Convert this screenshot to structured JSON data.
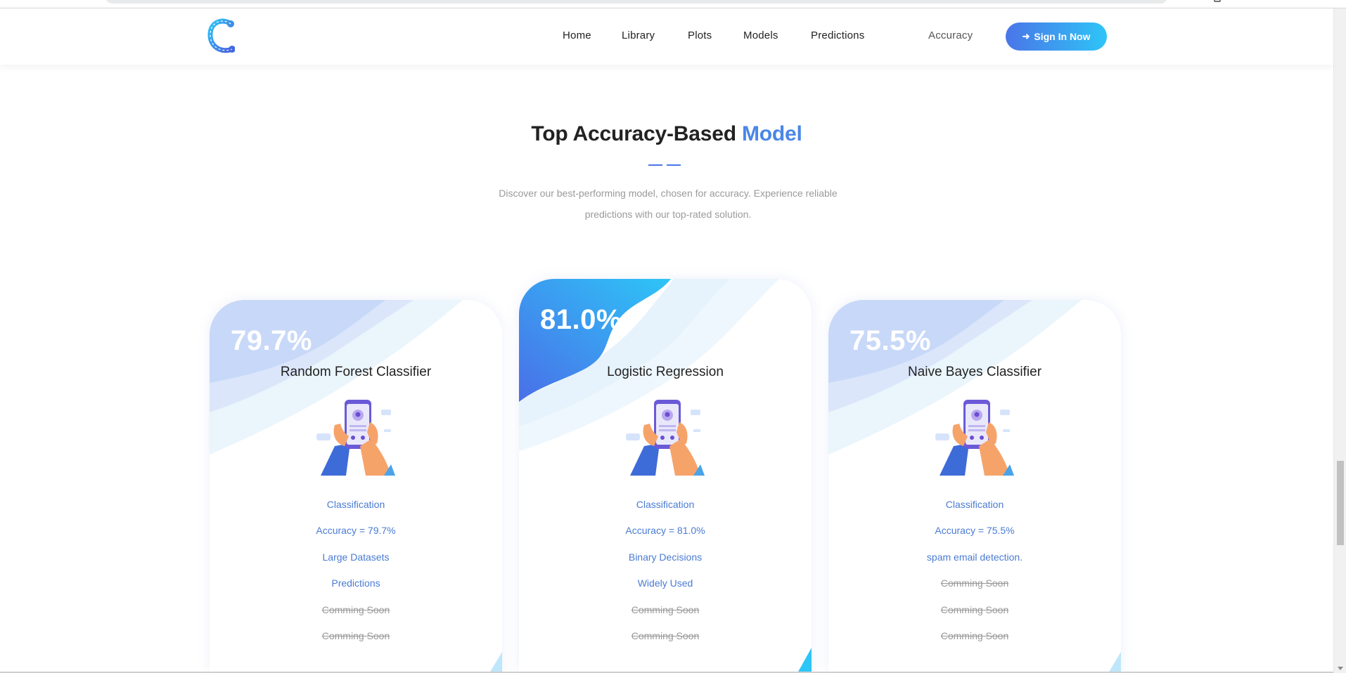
{
  "nav": {
    "items": [
      {
        "label": "Home"
      },
      {
        "label": "Library"
      },
      {
        "label": "Plots"
      },
      {
        "label": "Models"
      },
      {
        "label": "Predictions"
      },
      {
        "label": "Accuracy"
      }
    ],
    "signin_label": "Sign In Now",
    "signin_icon": "sign-in-icon"
  },
  "section": {
    "title_main": "Top Accuracy-Based ",
    "title_accent": "Model",
    "desc_line1": "Discover our best-performing model, chosen for accuracy. Experience reliable",
    "desc_line2": "predictions with our top-rated solution."
  },
  "cards": [
    {
      "percent": "79.7%",
      "name": "Random Forest Classifier",
      "features": [
        "Classification",
        "Accuracy = 79.7%",
        "Large Datasets",
        "Predictions"
      ],
      "coming": [
        "Comming Soon",
        "Comming Soon"
      ]
    },
    {
      "percent": "81.0%",
      "name": "Logistic Regression",
      "features": [
        "Classification",
        "Accuracy = 81.0%",
        "Binary Decisions",
        "Widely Used"
      ],
      "coming": [
        "Comming Soon",
        "Comming Soon"
      ]
    },
    {
      "percent": "75.5%",
      "name": "Naive Bayes Classifier",
      "features": [
        "Classification",
        "Accuracy = 75.5%",
        "spam email detection."
      ],
      "coming": [
        "Comming Soon",
        "Comming Soon",
        "Comming Soon"
      ]
    }
  ],
  "colors": {
    "accent": "#4a86e8",
    "gradient_start": "#4a75e8",
    "gradient_end": "#2ec5f7",
    "feature_text": "#4a7bd3"
  }
}
